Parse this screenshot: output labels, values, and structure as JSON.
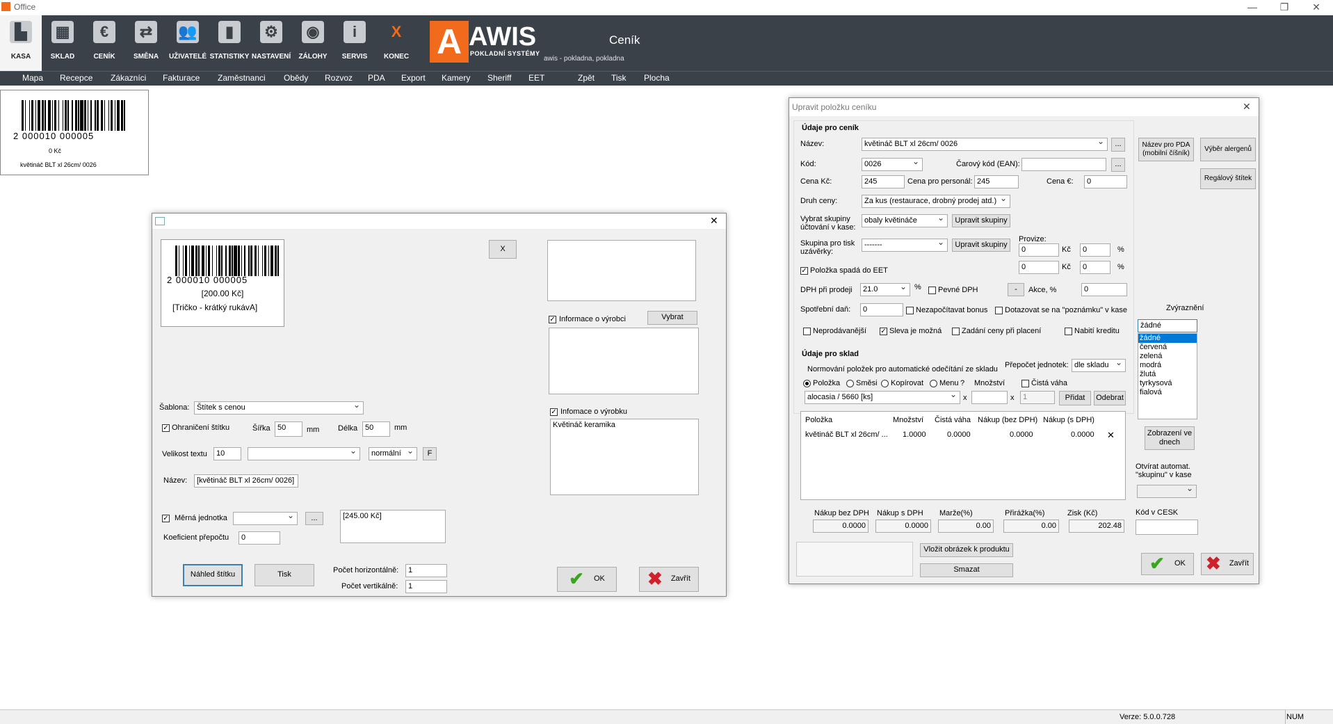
{
  "window": {
    "title": "Office",
    "minimize": "—",
    "restore": "❐",
    "close": "✕"
  },
  "toolbar": [
    {
      "label": "KASA",
      "icon": "cash-register-icon",
      "glyph": "▙"
    },
    {
      "label": "SKLAD",
      "icon": "warehouse-icon",
      "glyph": "▦"
    },
    {
      "label": "CENÍK",
      "icon": "euro-icon",
      "glyph": "€"
    },
    {
      "label": "SMĚNA",
      "icon": "exchange-icon",
      "glyph": "⇄"
    },
    {
      "label": "UŽIVATELÉ",
      "icon": "users-icon",
      "glyph": "👥"
    },
    {
      "label": "STATISTIKY",
      "icon": "stats-icon",
      "glyph": "▮"
    },
    {
      "label": "NASTAVENÍ",
      "icon": "gear-icon",
      "glyph": "⚙"
    },
    {
      "label": "ZÁLOHY",
      "icon": "backup-icon",
      "glyph": "◉"
    },
    {
      "label": "SERVIS",
      "icon": "info-icon",
      "glyph": "i"
    },
    {
      "label": "KONEC",
      "icon": "exit-icon",
      "glyph": "X"
    }
  ],
  "logo": {
    "letter": "A",
    "name": "AWIS",
    "sub": "POKLADNÍ SYSTÉMY"
  },
  "header": {
    "title": "Ceník",
    "subtitle": "awis - pokladna, pokladna"
  },
  "menu": [
    "Mapa",
    "Recepce",
    "Zákazníci",
    "Fakturace",
    "Zaměstnanci",
    "Obědy",
    "Rozvoz",
    "PDA",
    "Export",
    "Kamery",
    "Sheriff",
    "EET",
    "Zpět",
    "Tisk",
    "Plocha"
  ],
  "preview": {
    "barcode_digits": "2  000010  000005",
    "price": "0 Kč",
    "name": "květináč BLT xl 26cm/ 0026"
  },
  "label_dialog": {
    "close": "✕",
    "x_button": "X",
    "barcode_digits": "2  000010  000005",
    "price": "[200.00 Kč]",
    "name_preview": "[Tričko - krátký rukávA]",
    "manufacturer_check": "Informace o výrobci",
    "choose": "Vybrat",
    "product_check": "Infomace o výrobku",
    "product_info": "Květináč keramika",
    "template_label": "Šablona:",
    "template_value": "Štítek s cenou",
    "border_check": "Ohraničení štítku",
    "width_label": "Šířka",
    "width_value": "50",
    "mm1": "mm",
    "length_label": "Délka",
    "length_value": "50",
    "mm2": "mm",
    "textsize_label": "Velikost textu",
    "textsize_value": "10",
    "font_value": "",
    "style_value": "normální",
    "f_button": "F",
    "name_label": "Název:",
    "name_value": "[květináč BLT xl 26cm/ 0026]",
    "unit_check": "Měrná jednotka",
    "unit_more": "...",
    "unit_price": "[245.00 Kč]",
    "coef_label": "Koeficient přepočtu",
    "coef_value": "0",
    "preview_button": "Náhled štítku",
    "print_button": "Tisk",
    "horiz_label": "Počet horizontálně:",
    "horiz_value": "1",
    "vert_label": "Počet vertikálně:",
    "vert_value": "1",
    "ok": "OK",
    "close_button": "Zavřít"
  },
  "edit_dialog": {
    "title": "Upravit položku ceníku",
    "close": "✕",
    "section1": "Údaje pro ceník",
    "name_label": "Název:",
    "name_value": "květináč BLT xl 26cm/ 0026",
    "dots": "...",
    "pda_button": "Název pro PDA (mobilní číšník)",
    "allergen_button": "Výběr alergenů",
    "shelf_button": "Regálový štítek",
    "code_label": "Kód:",
    "code_value": "0026",
    "ean_label": "Čarový kód (EAN):",
    "ean_value": "",
    "price_label": "Cena Kč:",
    "price_value": "245",
    "staff_label": "Cena pro personál:",
    "staff_value": "245",
    "eur_label": "Cena €:",
    "eur_value": "0",
    "pricetype_label": "Druh ceny:",
    "pricetype_value": "Za kus (restaurace, drobný prodej atd.)",
    "group_label": "Vybrat skupiny účtování v kase:",
    "group_value": "obaly květináče",
    "edit_groups": "Upravit skupiny",
    "print_group_label": "Skupina pro tisk uzávěrky:",
    "print_group_value": "-------",
    "edit_groups2": "Upravit skupiny",
    "commission_label": "Provize:",
    "comm1_value": "0",
    "comm_kc1": "Kč",
    "comm1b_value": "0",
    "pct1": "%",
    "comm2_value": "0",
    "comm_kc2": "Kč",
    "comm2b_value": "0",
    "pct2": "%",
    "eet_check": "Položka spadá do EET",
    "vat_label": "DPH při prodeji",
    "vat_value": "21.0",
    "vat_pct": "%",
    "fixed_vat": "Pevné DPH",
    "dash_button": "-",
    "promo_label": "Akce, %",
    "promo_value": "0",
    "excise_label": "Spotřební daň:",
    "excise_value": "0",
    "nobonus": "Nezapočítavat bonus",
    "note_check": "Dotazovat se na \"poznámku\" v kase",
    "unsold": "Neprodávanější",
    "discount": "Sleva je možná",
    "price_on_pay": "Zadání ceny při placení",
    "credit": "Nabití kreditu",
    "section2": "Údaje pro sklad",
    "normalize": "Normování položek pro automatické odečítání ze skladu",
    "conv_label": "Přepočet jednotek:",
    "conv_value": "dle skladu",
    "radio_item": "Položka",
    "radio_mix": "Směsi",
    "radio_copy": "Kopírovat",
    "radio_menu": "Menu",
    "qmark": "?",
    "qty_label": "Množství",
    "netweight": "Čistá váha",
    "stock_value": "alocasia / 5660 [ks]",
    "times1": "x",
    "stock_qty": "",
    "times2": "x",
    "stock_qty2": "1",
    "add": "Přidat",
    "remove": "Odebrat",
    "table_headers": [
      "Položka",
      "Množství",
      "Čistá váha",
      "Nákup (bez DPH)",
      "Nákup (s DPH)"
    ],
    "table_rows": [
      [
        "květináč BLT xl 26cm/ ...",
        "1.0000",
        "0.0000",
        "0.0000",
        "0.0000"
      ]
    ],
    "row_delete": "✕",
    "sum_headers": [
      "Nákup bez DPH",
      "Nákup s DPH",
      "Marže(%)",
      "Přirážka(%)",
      "Zisk (Kč)"
    ],
    "sum_values": [
      "0.0000",
      "0.0000",
      "0.00",
      "0.00",
      "202.48"
    ],
    "image_button": "Vložit obrázek k produktu",
    "delete_button": "Smazat",
    "highlight_label": "Zvýraznění",
    "highlight_value": "žádné",
    "colors": [
      "žádné",
      "červená",
      "zelená",
      "modrá",
      "žlutá",
      "tyrkysová",
      "fialová"
    ],
    "today_button": "Zobrazení ve dnech",
    "open_group": "Otvírat automat. \"skupinu\" v kase",
    "cesk_label": "Kód v CESK",
    "ok": "OK",
    "close_button": "Zavřít"
  },
  "status": {
    "version": "Verze: 5.0.0.728",
    "num": "NUM"
  }
}
